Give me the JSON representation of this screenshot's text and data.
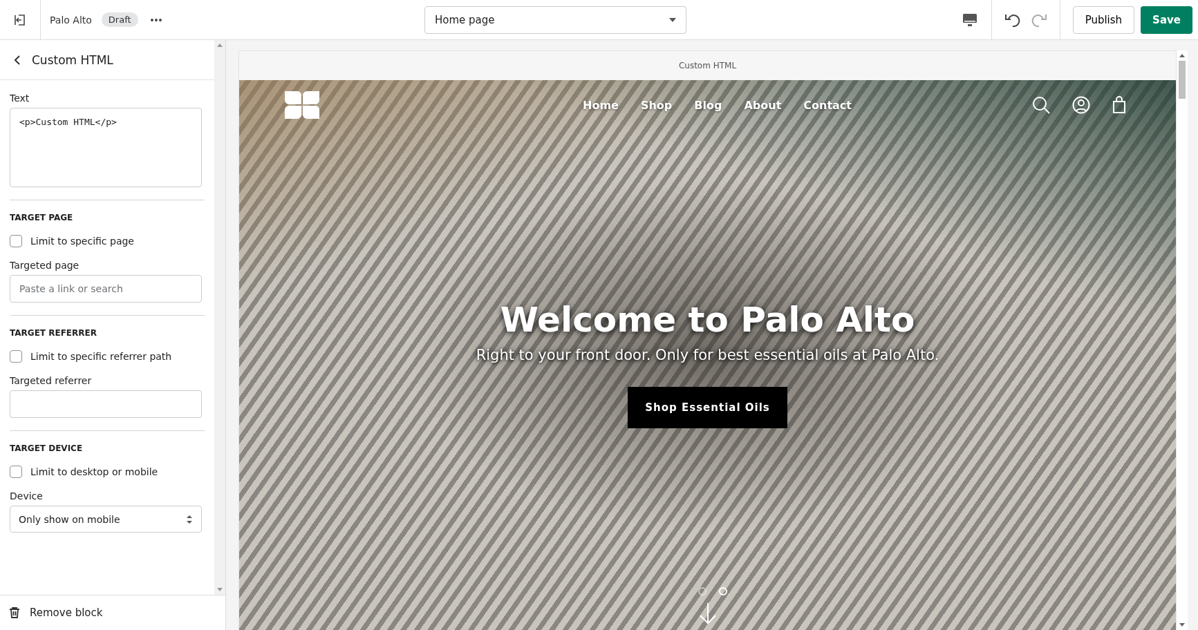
{
  "topbar": {
    "store_name": "Palo Alto",
    "status_badge": "Draft",
    "more": "•••",
    "page_select": "Home page",
    "publish": "Publish",
    "save": "Save"
  },
  "sidebar": {
    "title": "Custom HTML",
    "text_label": "Text",
    "text_value": "<p>Custom HTML</p>",
    "sections": [
      {
        "heading": "TARGET PAGE",
        "checkbox": "Limit to specific page",
        "checked": false,
        "field_label": "Targeted page",
        "kind": "input",
        "placeholder": "Paste a link or search"
      },
      {
        "heading": "TARGET REFERRER",
        "checkbox": "Limit to specific referrer path",
        "checked": false,
        "field_label": "Targeted referrer",
        "kind": "input"
      },
      {
        "heading": "TARGET DEVICE",
        "checkbox": "Limit to desktop or mobile",
        "checked": false,
        "field_label": "Device",
        "kind": "select",
        "value": "Only show on mobile"
      }
    ],
    "remove": "Remove block"
  },
  "preview": {
    "label": "Custom HTML",
    "nav": [
      {
        "label": "Home"
      },
      {
        "label": "Shop"
      },
      {
        "label": "Blog"
      },
      {
        "label": "About"
      },
      {
        "label": "Contact"
      }
    ],
    "heading": "Welcome to Palo Alto",
    "subheading": "Right to your front door. Only for best essential oils at Palo Alto.",
    "cta": "Shop Essential Oils",
    "slides": [
      {
        "selected": false
      },
      {
        "selected": true
      }
    ]
  }
}
